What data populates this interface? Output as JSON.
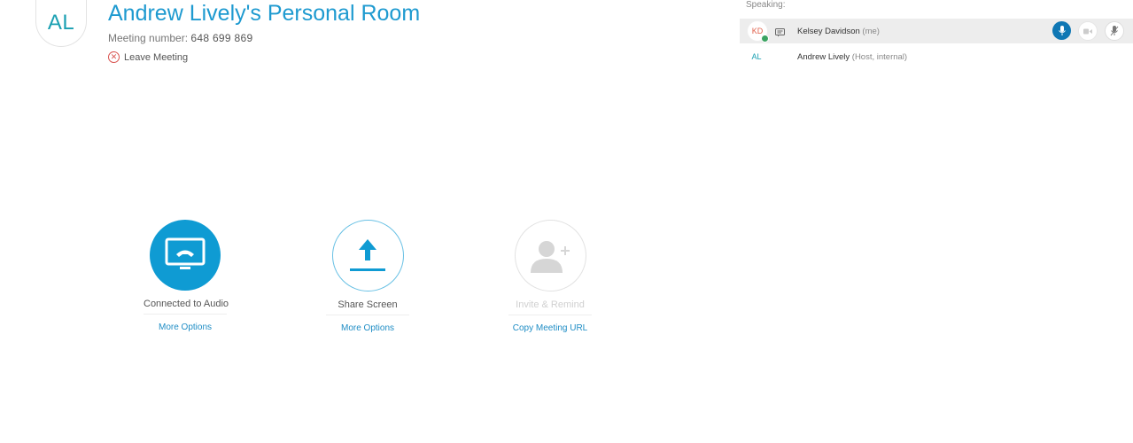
{
  "meeting": {
    "host_initials": "AL",
    "title": "Andrew Lively's Personal Room",
    "number_label": "Meeting number:",
    "number": "648 699 869",
    "leave_label": "Leave Meeting"
  },
  "participants": {
    "speaking_label": "Speaking:",
    "list": [
      {
        "initials": "KD",
        "name": "Kelsey Davidson",
        "role": "(me)"
      },
      {
        "initials": "AL",
        "name": "Andrew Lively",
        "role": "(Host, internal)"
      }
    ]
  },
  "actions": [
    {
      "label": "Connected to Audio",
      "link": "More Options"
    },
    {
      "label": "Share Screen",
      "link": "More Options"
    },
    {
      "label": "Invite & Remind",
      "link": "Copy Meeting URL"
    }
  ],
  "colors": {
    "accent": "#1e9ad0",
    "audio_button": "#0f9bd3",
    "mic_active": "#0f77b4",
    "leave_red": "#d9534f"
  }
}
